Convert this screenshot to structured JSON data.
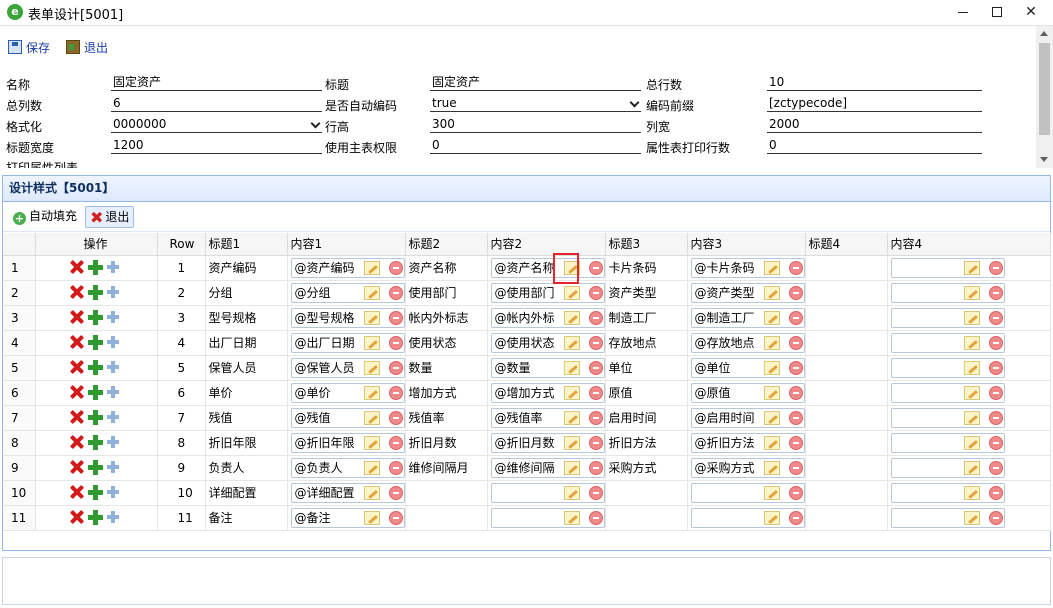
{
  "window": {
    "title": "表单设计[5001]"
  },
  "toolbar": {
    "save_label": "保存",
    "exit_label": "退出"
  },
  "form": {
    "row1": {
      "name_label": "名称",
      "name_value": "固定资产",
      "title_label": "标题",
      "title_value": "固定资产",
      "total_rows_label": "总行数",
      "total_rows_value": "10"
    },
    "row2": {
      "total_cols_label": "总列数",
      "total_cols_value": "6",
      "auto_code_label": "是否自动编码",
      "auto_code_value": "true",
      "code_prefix_label": "编码前缀",
      "code_prefix_value": "[zctypecode]"
    },
    "row3": {
      "format_label": "格式化",
      "format_value": "0000000",
      "row_height_label": "行高",
      "row_height_value": "300",
      "col_width_label": "列宽",
      "col_width_value": "2000"
    },
    "row4": {
      "title_width_label": "标题宽度",
      "title_width_value": "1200",
      "use_main_perm_label": "使用主表权限",
      "use_main_perm_value": "0",
      "attr_print_rows_label": "属性表打印行数",
      "attr_print_rows_value": "0"
    },
    "row5": {
      "print_attr_list_label": "打印属性列表"
    }
  },
  "design": {
    "header": "设计样式【5001】",
    "autofill_label": "自动填充",
    "exit_label": "退出",
    "columns": {
      "op": "操作",
      "row": "Row",
      "title1": "标题1",
      "content1": "内容1",
      "title2": "标题2",
      "content2": "内容2",
      "title3": "标题3",
      "content3": "内容3",
      "title4": "标题4",
      "content4": "内容4"
    },
    "rows": [
      {
        "idx": "1",
        "row": "1",
        "t1": "资产编码",
        "c1": "@资产编码",
        "t2": "资产名称",
        "c2": "@资产名称",
        "t3": "卡片条码",
        "c3": "@卡片条码",
        "t4": "",
        "c4": ""
      },
      {
        "idx": "2",
        "row": "2",
        "t1": "分组",
        "c1": "@分组",
        "t2": "使用部门",
        "c2": "@使用部门",
        "t3": "资产类型",
        "c3": "@资产类型",
        "t4": "",
        "c4": ""
      },
      {
        "idx": "3",
        "row": "3",
        "t1": "型号规格",
        "c1": "@型号规格",
        "t2": "帐内外标志",
        "c2": "@帐内外标",
        "t3": "制造工厂",
        "c3": "@制造工厂",
        "t4": "",
        "c4": ""
      },
      {
        "idx": "4",
        "row": "4",
        "t1": "出厂日期",
        "c1": "@出厂日期",
        "t2": "使用状态",
        "c2": "@使用状态",
        "t3": "存放地点",
        "c3": "@存放地点",
        "t4": "",
        "c4": ""
      },
      {
        "idx": "5",
        "row": "5",
        "t1": "保管人员",
        "c1": "@保管人员",
        "t2": "数量",
        "c2": "@数量",
        "t3": "单位",
        "c3": "@单位",
        "t4": "",
        "c4": ""
      },
      {
        "idx": "6",
        "row": "6",
        "t1": "单价",
        "c1": "@单价",
        "t2": "增加方式",
        "c2": "@增加方式",
        "t3": "原值",
        "c3": "@原值",
        "t4": "",
        "c4": ""
      },
      {
        "idx": "7",
        "row": "7",
        "t1": "残值",
        "c1": "@残值",
        "t2": "残值率",
        "c2": "@残值率",
        "t3": "启用时间",
        "c3": "@启用时间",
        "t4": "",
        "c4": ""
      },
      {
        "idx": "8",
        "row": "8",
        "t1": "折旧年限",
        "c1": "@折旧年限",
        "t2": "折旧月数",
        "c2": "@折旧月数",
        "t3": "折旧方法",
        "c3": "@折旧方法",
        "t4": "",
        "c4": ""
      },
      {
        "idx": "9",
        "row": "9",
        "t1": "负责人",
        "c1": "@负责人",
        "t2": "维修间隔月",
        "c2": "@维修间隔",
        "t3": "采购方式",
        "c3": "@采购方式",
        "t4": "",
        "c4": ""
      },
      {
        "idx": "10",
        "row": "10",
        "t1": "详细配置",
        "c1": "@详细配置",
        "t2": "",
        "c2": "",
        "t3": "",
        "c3": "",
        "t4": "",
        "c4": ""
      },
      {
        "idx": "11",
        "row": "11",
        "t1": "备注",
        "c1": "@备注",
        "t2": "",
        "c2": "",
        "t3": "",
        "c3": "",
        "t4": "",
        "c4": ""
      }
    ]
  },
  "icons": {
    "app": "ie-icon",
    "edit": "pencil-icon",
    "remove": "remove-icon",
    "delete": "delete-row-icon",
    "add": "add-row-icon",
    "insert": "insert-row-icon"
  }
}
